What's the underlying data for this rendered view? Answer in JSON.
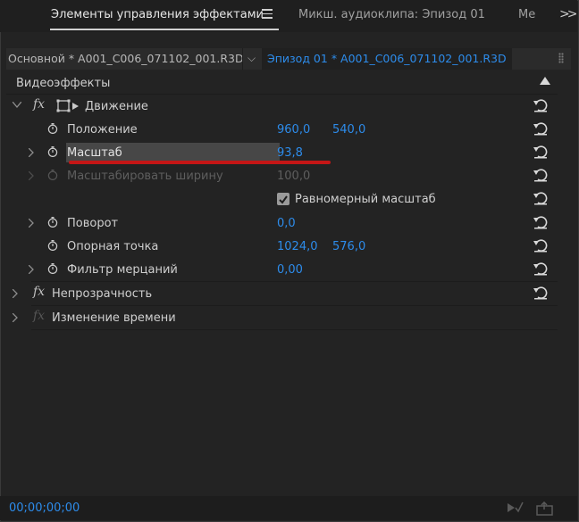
{
  "tabs": [
    {
      "label": "Элементы управления эффектами",
      "active": true
    },
    {
      "label": "Микш. аудиоклипа: Эпизод 01",
      "active": false
    },
    {
      "label": "Ме",
      "active": false
    }
  ],
  "source": {
    "main_clip": "Основной * A001_C006_071102_001.R3D",
    "sequence_clip": "Эпизод 01 * A001_C006_071102_001.R3D"
  },
  "panel": {
    "section_label": "Видеоэффекты",
    "motion": {
      "label": "Движение",
      "position": {
        "label": "Положение",
        "x": "960,0",
        "y": "540,0"
      },
      "scale": {
        "label": "Масштаб",
        "value": "93,8"
      },
      "scale_width": {
        "label": "Масштабировать ширину",
        "value": "100,0"
      },
      "uniform_scale": {
        "label": "Равномерный масштаб",
        "checked": true
      },
      "rotation": {
        "label": "Поворот",
        "value": "0,0"
      },
      "anchor_point": {
        "label": "Опорная точка",
        "x": "1024,0",
        "y": "576,0"
      },
      "flicker_filter": {
        "label": "Фильтр мерцаний",
        "value": "0,00"
      }
    },
    "opacity": {
      "label": "Непрозрачность"
    },
    "time_remapping": {
      "label": "Изменение времени"
    }
  },
  "footer": {
    "timecode": "00;00;00;00"
  },
  "colors": {
    "accent_blue": "#2d8ceb",
    "annotation_red": "#c41616",
    "panel_bg": "#232323"
  }
}
